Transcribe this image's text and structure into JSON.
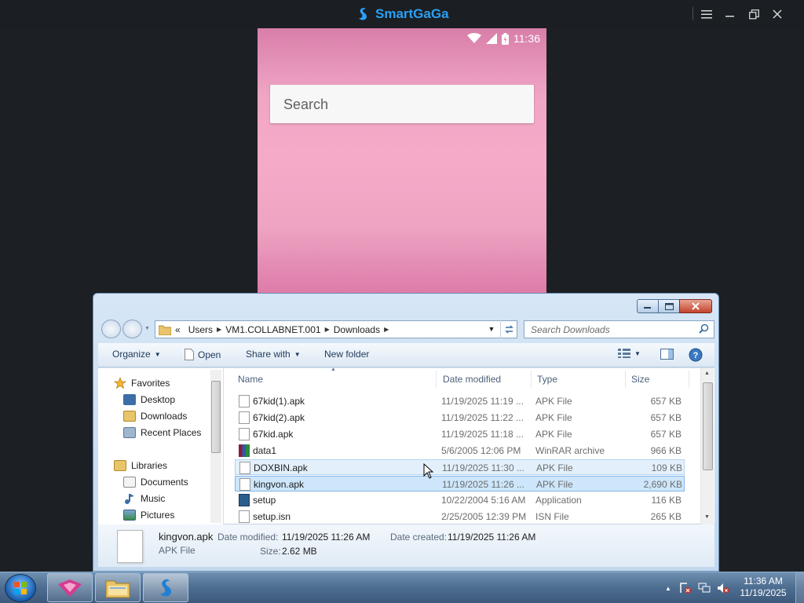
{
  "emulator": {
    "title": "SmartGaGa",
    "controls": [
      "menu",
      "minimize",
      "restore",
      "close"
    ]
  },
  "android": {
    "time": "11:36",
    "search_placeholder": "Search"
  },
  "explorer": {
    "breadcrumb": [
      "«",
      "Users",
      "VM1.COLLABNET.001",
      "Downloads"
    ],
    "search_placeholder": "Search Downloads",
    "toolbar": {
      "organize": "Organize",
      "open": "Open",
      "share_with": "Share with",
      "new_folder": "New folder"
    },
    "nav": {
      "favorites": "Favorites",
      "desktop": "Desktop",
      "downloads": "Downloads",
      "recent_places": "Recent Places",
      "libraries": "Libraries",
      "documents": "Documents",
      "music": "Music",
      "pictures": "Pictures"
    },
    "columns": {
      "name": "Name",
      "date": "Date modified",
      "type": "Type",
      "size": "Size"
    },
    "files": [
      {
        "name": "67kid(1).apk",
        "date": "11/19/2025 11:19 ...",
        "type": "APK File",
        "size": "657 KB",
        "icon": "file-icon"
      },
      {
        "name": "67kid(2).apk",
        "date": "11/19/2025 11:22 ...",
        "type": "APK File",
        "size": "657 KB",
        "icon": "file-icon"
      },
      {
        "name": "67kid.apk",
        "date": "11/19/2025 11:18 ...",
        "type": "APK File",
        "size": "657 KB",
        "icon": "file-icon"
      },
      {
        "name": "data1",
        "date": "5/6/2005 12:06 PM",
        "type": "WinRAR archive",
        "size": "966 KB",
        "icon": "winrar-icon"
      },
      {
        "name": "DOXBIN.apk",
        "date": "11/19/2025 11:30 ...",
        "type": "APK File",
        "size": "109 KB",
        "icon": "file-icon"
      },
      {
        "name": "kingvon.apk",
        "date": "11/19/2025 11:26 ...",
        "type": "APK File",
        "size": "2,690 KB",
        "icon": "file-icon"
      },
      {
        "name": "setup",
        "date": "10/22/2004 5:16 AM",
        "type": "Application",
        "size": "116 KB",
        "icon": "application-icon"
      },
      {
        "name": "setup.isn",
        "date": "2/25/2005 12:39 PM",
        "type": "ISN File",
        "size": "265 KB",
        "icon": "file-icon"
      }
    ],
    "details": {
      "file_name": "kingvon.apk",
      "file_type": "APK File",
      "date_modified_label": "Date modified:",
      "date_modified": "11/19/2025 11:26 AM",
      "date_created_label": "Date created:",
      "date_created": "11/19/2025 11:26 AM",
      "size_label": "Size:",
      "size": "2.62 MB"
    }
  },
  "taskbar": {
    "time": "11:36 AM",
    "date": "11/19/2025"
  },
  "colors": {
    "emulator_brand": "#2aa0f3",
    "selection": "#cde6fb",
    "hover": "#e3f0fb"
  }
}
